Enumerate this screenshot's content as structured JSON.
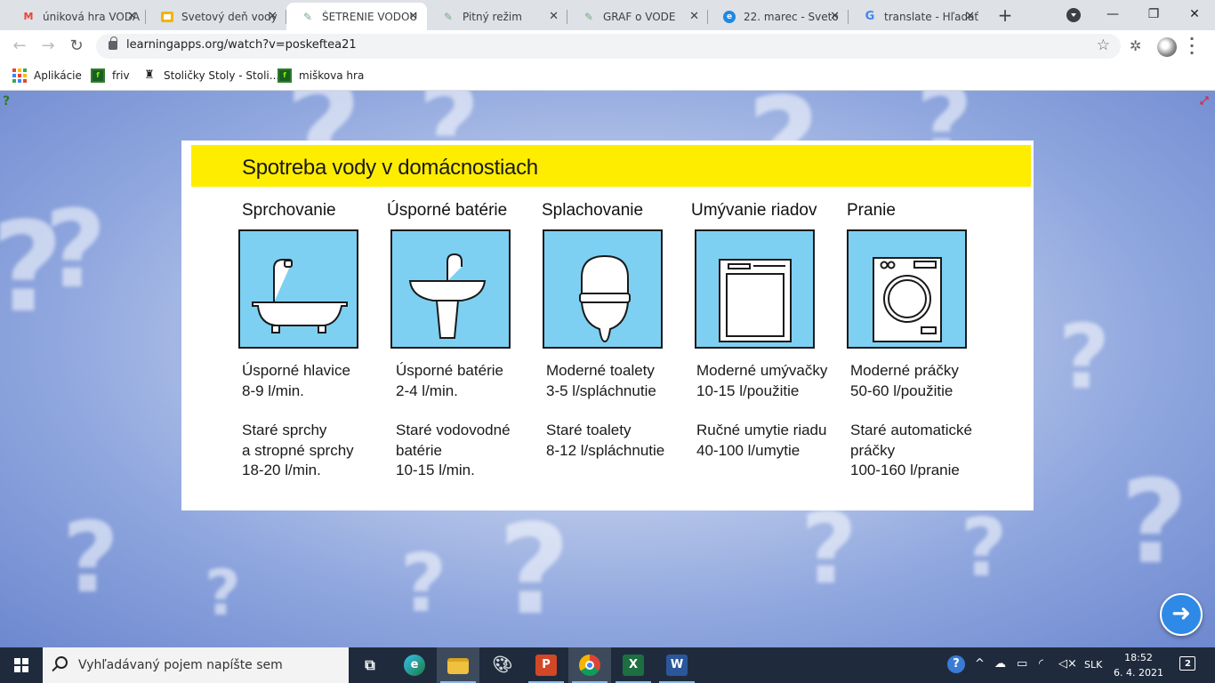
{
  "browser": {
    "tabs": [
      {
        "title": "úniková hra VODA",
        "icon": "gmail-icon",
        "color": "#ea4335",
        "glyph": "M",
        "active": false
      },
      {
        "title": "Svetový deň vody",
        "icon": "slides-icon",
        "color": "#f4b400",
        "glyph": "▭",
        "active": false
      },
      {
        "title": "ŠETRENIE VODOU",
        "icon": "learningapps-icon",
        "color": "#6a8",
        "glyph": "✎",
        "active": true
      },
      {
        "title": "Pitný režim",
        "icon": "learningapps-icon",
        "color": "#6a8",
        "glyph": "✎",
        "active": false
      },
      {
        "title": "GRAF o VODE",
        "icon": "learningapps-icon",
        "color": "#6a8",
        "glyph": "✎",
        "active": false
      },
      {
        "title": "22. marec - Sveto",
        "icon": "edge-icon",
        "color": "#1e88e5",
        "glyph": "e",
        "active": false
      },
      {
        "title": "translate - Hľadať",
        "icon": "google-icon",
        "color": "#4285f4",
        "glyph": "G",
        "active": false
      }
    ],
    "url": "learningapps.org/watch?v=poskeftea21",
    "bookmarks": [
      {
        "label": "Aplikácie",
        "icon": "apps-grid-icon"
      },
      {
        "label": "friv",
        "icon": "friv-icon"
      },
      {
        "label": "Stoličky Stoly - Stoli...",
        "icon": "chair-icon"
      },
      {
        "label": "miškova hra",
        "icon": "friv-icon"
      }
    ]
  },
  "poster": {
    "title": "Spotreba vody v domácnostiach",
    "columns": [
      {
        "heading": "Sprchovanie",
        "icon": "bathtub-icon",
        "saving": [
          "Úsporné hlavice",
          "8-9 l/min."
        ],
        "old": [
          "Staré sprchy",
          "a stropné sprchy",
          "18-20 l/min."
        ]
      },
      {
        "heading": "Úsporné batérie",
        "icon": "sink-icon",
        "saving": [
          "Úsporné batérie",
          "2-4 l/min."
        ],
        "old": [
          "Staré vodovodné",
          "batérie",
          "10-15 l/min."
        ]
      },
      {
        "heading": "Splachovanie",
        "icon": "toilet-icon",
        "saving": [
          "Moderné toalety",
          "3-5 l/spláchnutie"
        ],
        "old": [
          "Staré toalety",
          "8-12 l/spláchnutie"
        ]
      },
      {
        "heading": "Umývanie riadov",
        "icon": "dishwasher-icon",
        "saving": [
          "Moderné umývačky",
          "10-15 l/použitie"
        ],
        "old": [
          "Ručné umytie riadu",
          "40-100 l/umytie"
        ]
      },
      {
        "heading": "Pranie",
        "icon": "washing-machine-icon",
        "saving": [
          "Moderné práčky",
          "50-60 l/použitie"
        ],
        "old": [
          "Staré automatické",
          "práčky",
          "100-160 l/pranie"
        ]
      }
    ],
    "banner_color": "#ffed00",
    "tile_color": "#7dd0f1"
  },
  "taskbar": {
    "search_placeholder": "Vyhľadávaný pojem napíšte sem",
    "language": "SLK",
    "time": "18:52",
    "date": "6. 4. 2021",
    "notifications": "2",
    "apps": [
      {
        "name": "task-view-icon"
      },
      {
        "name": "edge-icon"
      },
      {
        "name": "file-explorer-icon"
      },
      {
        "name": "paint-icon"
      },
      {
        "name": "powerpoint-icon"
      },
      {
        "name": "chrome-icon"
      },
      {
        "name": "excel-icon"
      },
      {
        "name": "word-icon"
      }
    ]
  }
}
